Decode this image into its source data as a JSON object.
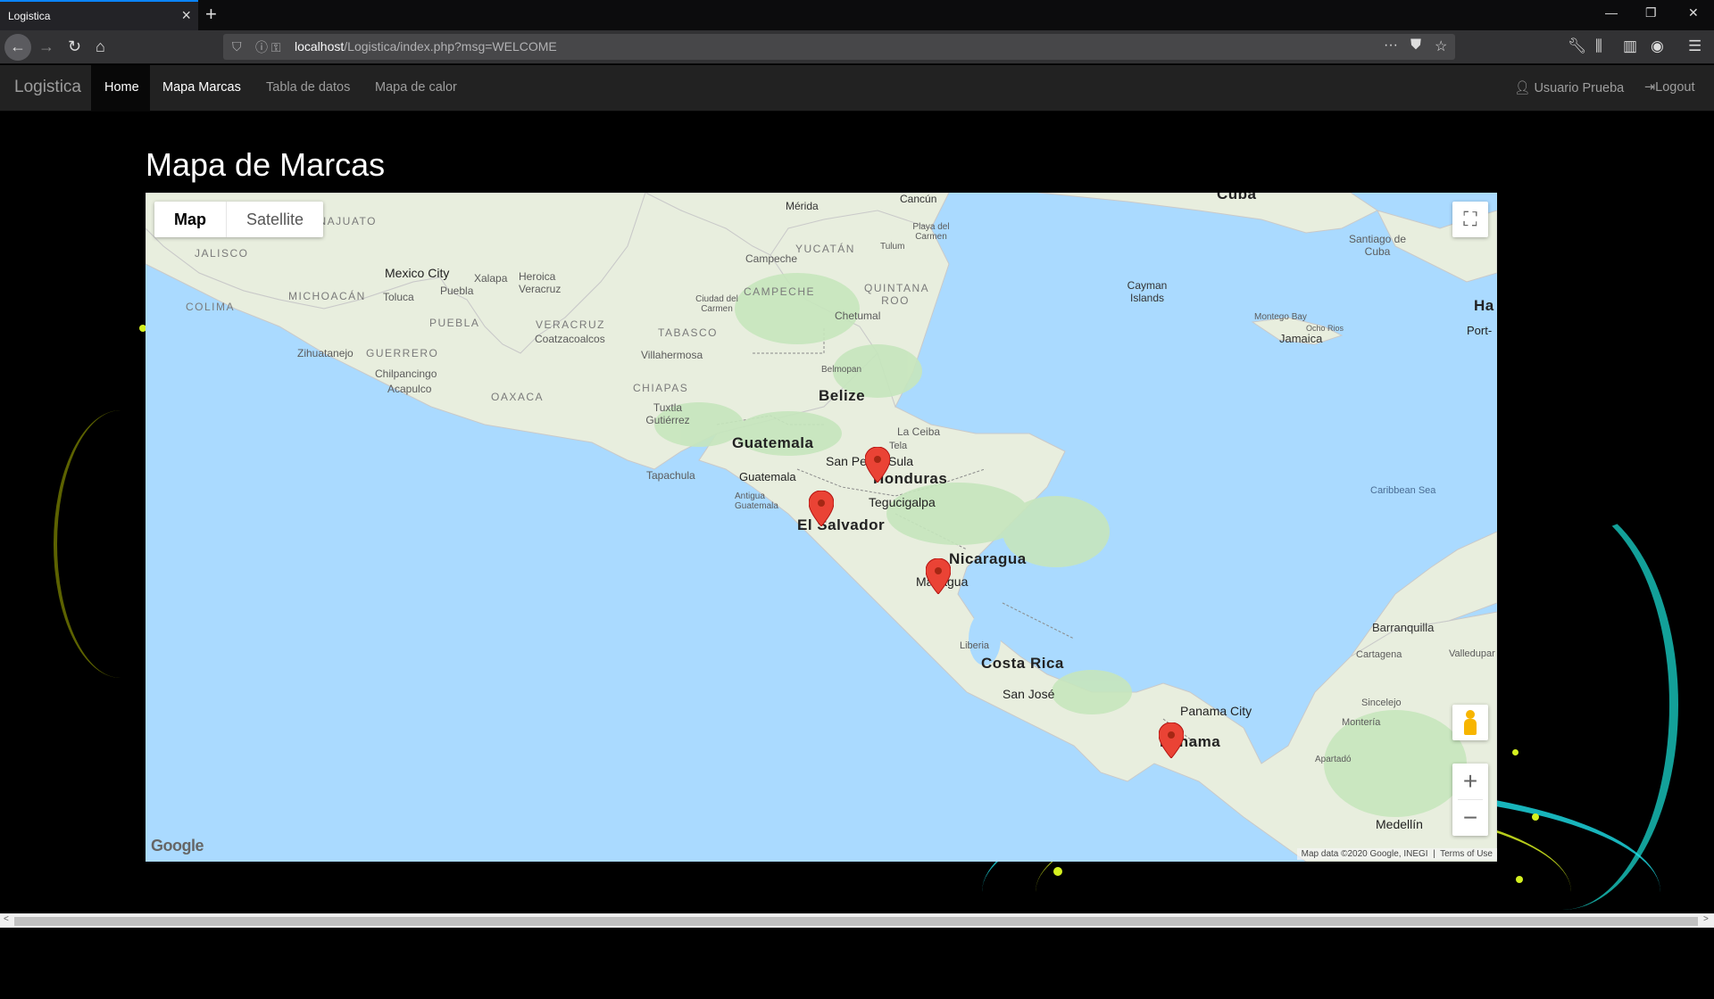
{
  "browser": {
    "tab_title": "Logistica",
    "url_host": "localhost",
    "url_path": "/Logistica/index.php?msg=WELCOME"
  },
  "navbar": {
    "brand": "Logistica",
    "links": [
      "Home",
      "Mapa Marcas",
      "Tabla de datos",
      "Mapa de calor"
    ],
    "user": "Usuario Prueba",
    "logout": "Logout"
  },
  "page": {
    "title": "Mapa de Marcas"
  },
  "map": {
    "type_buttons": [
      "Map",
      "Satellite"
    ],
    "selected_type": "Map",
    "google": "Google",
    "attribution": "Map data ©2020 Google, INEGI",
    "terms": "Terms of Use",
    "marker_color": "#ea4335",
    "markers": [
      "San Pedro Sula, Honduras",
      "San Salvador, El Salvador",
      "Managua, Nicaragua",
      "Panama"
    ],
    "labels": {
      "countries": [
        "Belize",
        "Guatemala",
        "Honduras",
        "El Salvador",
        "Nicaragua",
        "Costa Rica",
        "Panama"
      ],
      "cities": [
        "Mérida",
        "Cancún",
        "Campeche",
        "Playa del Carmen",
        "Tulum",
        "Mexico City",
        "Toluca",
        "Puebla",
        "Xalapa",
        "Heroica Veracruz",
        "Ciudad del Carmen",
        "Chetumal",
        "Coatzacoalcos",
        "Villahermosa",
        "Belmopan",
        "Zihuatanejo",
        "Chilpancingo",
        "Acapulco",
        "Tuxtla Gutiérrez",
        "La Ceiba",
        "Tela",
        "San Pedro Sula",
        "Tapachula",
        "Guatemala",
        "Antigua Guatemala",
        "Tegucigalpa",
        "Managua",
        "Liberia",
        "San José",
        "Panama City",
        "Santiago de Cuba",
        "Montego Bay",
        "Ocho Rios",
        "Jamaica",
        "Cayman Islands",
        "Barranquilla",
        "Cartagena",
        "Valledupar",
        "Sincelejo",
        "Montería",
        "Apartadó",
        "Medellín",
        "Port-",
        "Ha",
        "Cuba"
      ],
      "states": [
        "JALISCO",
        "COLIMA",
        "MICHOACÁN",
        "GUERRERO",
        "OAXACA",
        "PUEBLA",
        "VERACRUZ",
        "TABASCO",
        "CHIAPAS",
        "YUCATÁN",
        "CAMPECHE",
        "QUINTANA ROO",
        "GUANAJUATO"
      ],
      "sea": "Caribbean Sea"
    }
  }
}
